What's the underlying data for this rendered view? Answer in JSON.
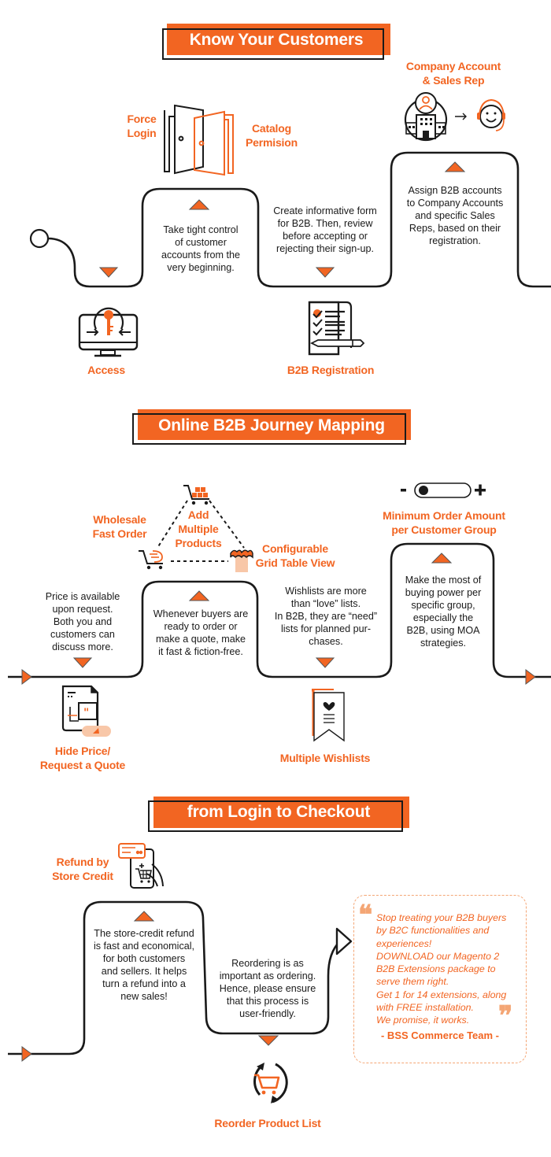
{
  "colors": {
    "accent": "#f26522",
    "accent_light": "#f4a675",
    "ink": "#1a1a1a",
    "background": "#ffffff"
  },
  "sections": [
    {
      "title": "Know Your Customers",
      "features": [
        {
          "label_lines": [
            "Force",
            "Login"
          ],
          "icon": "door-icon"
        },
        {
          "label_lines": [
            "Catalog",
            "Permision"
          ],
          "icon": "door-open-icon"
        },
        {
          "label_lines": [
            "Company Account",
            "& Sales Rep"
          ],
          "icon": "company-to-sales-rep-icon"
        },
        {
          "label_lines": [
            "Access"
          ],
          "icon": "monitor-key-icon"
        },
        {
          "label_lines": [
            "B2B Registration"
          ],
          "icon": "checklist-form-icon"
        }
      ],
      "descriptions": [
        [
          "Take tight control",
          "of customer",
          "accounts from the",
          "very beginning."
        ],
        [
          "Create informative form",
          "for B2B. Then, review",
          "before accepting or",
          "rejecting their sign-up."
        ],
        [
          "Assign B2B accounts",
          "to Company Accounts",
          "and specific Sales",
          "Reps, based on their",
          "registration."
        ]
      ]
    },
    {
      "title": "Online B2B Journey Mapping",
      "features": [
        {
          "label_lines": [
            "Wholesale",
            "Fast Order"
          ],
          "icon": "fast-cart-icon"
        },
        {
          "label_lines": [
            "Add",
            "Multiple",
            "Products"
          ],
          "icon": "cart-boxes-icon"
        },
        {
          "label_lines": [
            "Configurable",
            "Grid Table View"
          ],
          "icon": "shirt-icon"
        },
        {
          "label_lines": [
            "Minimum Order Amount",
            "per Customer Group"
          ],
          "icon": "slider-toggle-icon"
        },
        {
          "label_lines": [
            "Hide Price/",
            "Request a Quote"
          ],
          "icon": "quote-document-icon"
        },
        {
          "label_lines": [
            "Multiple Wishlists"
          ],
          "icon": "bookmark-heart-icon"
        }
      ],
      "descriptions": [
        [
          "Price is available",
          "upon request.",
          "Both you and",
          "customers can",
          "discuss more."
        ],
        [
          "Whenever buyers are",
          "ready to order or",
          "make a quote, make",
          "it fast & fiction-free."
        ],
        [
          "Wishlists are more",
          "than “love” lists.",
          "In B2B, they are “need”",
          "lists for planned pur-",
          "chases."
        ],
        [
          "Make the most of",
          "buying power per",
          "specific group,",
          "especially the",
          "B2B, using MOA",
          "strategies."
        ]
      ]
    },
    {
      "title": "from Login to Checkout",
      "features": [
        {
          "label_lines": [
            "Refund by",
            "Store Credit"
          ],
          "icon": "phone-card-cart-icon"
        },
        {
          "label_lines": [
            "Reorder Product List"
          ],
          "icon": "reorder-cart-icon"
        }
      ],
      "descriptions": [
        [
          "The store-credit refund",
          "is fast and economical,",
          "for both customers",
          "and sellers. It helps",
          "turn a refund into a",
          "new sales!"
        ],
        [
          "Reordering is as",
          "important as ordering.",
          "Hence, please ensure",
          "that this process is",
          "user-friendly."
        ]
      ]
    }
  ],
  "quote": {
    "lines": [
      "Stop treating your B2B buyers",
      "by B2C functionalities and",
      "experiences!",
      "DOWNLOAD our Magento 2",
      "B2B Extensions package to",
      "serve them right.",
      "Get 1 for 14 extensions, along",
      "with FREE installation.",
      "We promise, it works."
    ],
    "signature": "- BSS Commerce Team -",
    "open_mark": "❝",
    "close_mark": "❞"
  },
  "slider": {
    "minus": "−",
    "plus": "+",
    "level": 0
  }
}
